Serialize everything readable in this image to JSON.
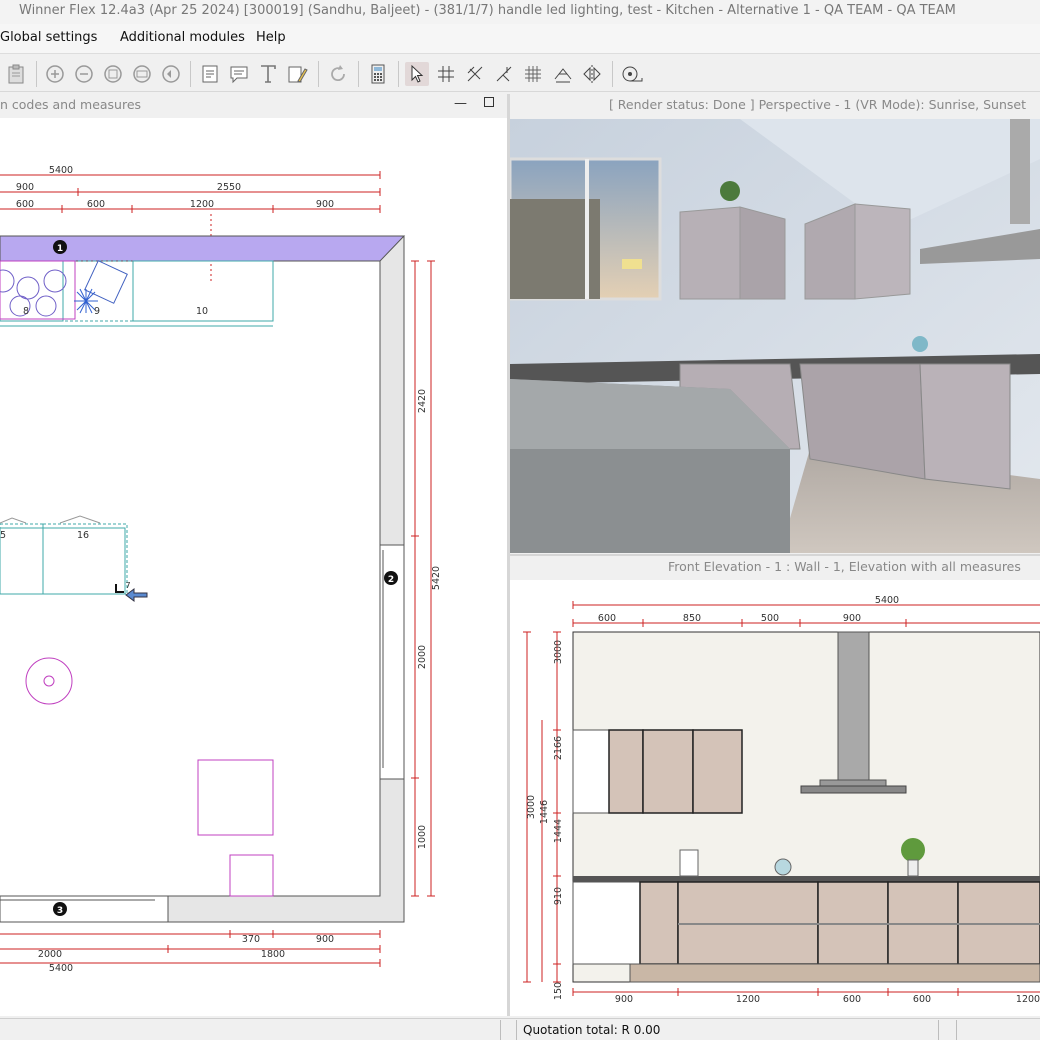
{
  "window": {
    "title": "Winner Flex 12.4a3  (Apr 25 2024) [300019]  (Sandhu, Baljeet) - (381/1/7) handle led lighting, test - Kitchen - Alternative 1 - QA TEAM  - QA TEAM"
  },
  "menu": {
    "items": [
      "Global settings",
      "Additional modules",
      "Help"
    ]
  },
  "toolbar": {
    "icons": [
      "clipboard-icon",
      "zoom-in-icon",
      "zoom-out-icon",
      "zoom-fit-icon",
      "zoom-window-icon",
      "zoom-previous-icon",
      "note-icon",
      "comment-icon",
      "text-icon",
      "drawing-tool-icon",
      "refresh-icon",
      "calculator-icon",
      "select-arrow-icon",
      "wall-tool-icon",
      "wall-corner-icon",
      "wall-split-icon",
      "grid-icon",
      "dimension-icon",
      "mirror-icon",
      "measure-tape-icon"
    ]
  },
  "plan_view": {
    "title": "n codes and measures",
    "top_dims": {
      "total": "5400",
      "row2": [
        "900",
        "2550"
      ],
      "row3": [
        "600",
        "600",
        "1200",
        "900"
      ]
    },
    "right_dims": [
      "2420",
      "2000",
      "1000"
    ],
    "right_total": "5420",
    "bottom_dims": {
      "row1": [
        "370",
        "900"
      ],
      "row2": [
        "2000",
        "1800"
      ],
      "total": "5400"
    },
    "wall_markers": [
      "1",
      "2",
      "3"
    ],
    "cabinet_labels": [
      "8",
      "9",
      "10",
      "5",
      "16",
      "7"
    ]
  },
  "render_view": {
    "title": "[ Render status: Done ] Perspective - 1 (VR Mode): Sunrise, Sunset"
  },
  "elevation_view": {
    "title": "Front Elevation - 1 : Wall - 1, Elevation with all measures",
    "top_total": "5400",
    "top_dims": [
      "600",
      "850",
      "500",
      "900"
    ],
    "left_dims": [
      "3000",
      "2166",
      "1444",
      "910",
      "150"
    ],
    "left_outer": [
      "3000",
      "1446"
    ],
    "bottom_dims": [
      "900",
      "1200",
      "600",
      "600",
      "1200"
    ]
  },
  "status": {
    "quotation": "Quotation total: R 0.00"
  },
  "colors": {
    "wall_band": "#b8a8f0",
    "dimension_line": "#cc2222",
    "cabinet_line": "#3fa9a9",
    "appliance_line": "#c040c0",
    "cabinet_fill": "#d4c3b8"
  }
}
